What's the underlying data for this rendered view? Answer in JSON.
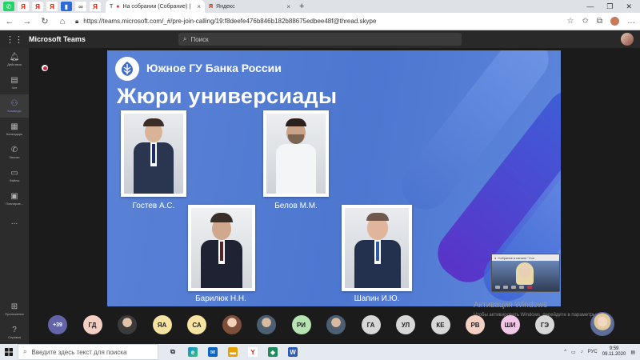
{
  "browser": {
    "tabs": [
      {
        "label": "На собрании (Собрание) |",
        "active": true
      },
      {
        "label": "Яндекс",
        "active": false
      }
    ],
    "url": "https://teams.microsoft.com/_#/pre-join-calling/19:f8deefe476b846b182b88675edbee48f@thread.skype"
  },
  "teams": {
    "app_title": "Microsoft Teams",
    "search_placeholder": "Поиск"
  },
  "rail": {
    "items": [
      {
        "label": "Действия",
        "icon": "bell-icon"
      },
      {
        "label": "Чат",
        "icon": "chat-icon"
      },
      {
        "label": "Команды",
        "icon": "teams-icon",
        "active": true
      },
      {
        "label": "Календарь",
        "icon": "calendar-icon"
      },
      {
        "label": "Звонки",
        "icon": "phone-icon"
      },
      {
        "label": "Файлы",
        "icon": "files-icon"
      },
      {
        "label": "Планиров...",
        "icon": "planner-icon"
      },
      {
        "label": "...",
        "icon": "more-icon"
      }
    ],
    "bottom": [
      {
        "label": "Приложения",
        "icon": "apps-icon"
      },
      {
        "label": "Справка",
        "icon": "help-icon"
      }
    ]
  },
  "slide": {
    "bank_name": "Южное ГУ Банка России",
    "title": "Жюри универсиады",
    "people": [
      {
        "name": "Гостев А.С."
      },
      {
        "name": "Белов М.М."
      },
      {
        "name": "Барилюк Н.Н."
      },
      {
        "name": "Шапин И.Ю."
      }
    ]
  },
  "self_view": {
    "header": "Собрание в канале \"Уча"
  },
  "watermark": {
    "title": "Активация Windows",
    "subtitle": "Чтобы активировать Windows, перейдите в параметры"
  },
  "participants": [
    {
      "label": "+39",
      "kind": "count"
    },
    {
      "label": "ГД",
      "color": "#f4cfc4"
    },
    {
      "label": "",
      "kind": "photo"
    },
    {
      "label": "ЯА",
      "color": "#f6e3a1"
    },
    {
      "label": "СА",
      "color": "#f6e3a1"
    },
    {
      "label": "",
      "kind": "photo2"
    },
    {
      "label": "",
      "kind": "photo3"
    },
    {
      "label": "РИ",
      "color": "#b6e3b1"
    },
    {
      "label": "",
      "kind": "photo3"
    },
    {
      "label": "ГА",
      "color": "#d7d7d7"
    },
    {
      "label": "УЛ",
      "color": "#d7d7d7"
    },
    {
      "label": "КЕ",
      "color": "#d7d7d7"
    },
    {
      "label": "РВ",
      "color": "#f4cfc4"
    },
    {
      "label": "ШИ",
      "color": "#f2c6e6"
    },
    {
      "label": "ГЭ",
      "color": "#d7d7d7"
    }
  ],
  "taskbar": {
    "search_placeholder": "Введите здесь текст для поиска",
    "lang": "РУС",
    "time": "9:59",
    "date": "09.11.2020"
  }
}
